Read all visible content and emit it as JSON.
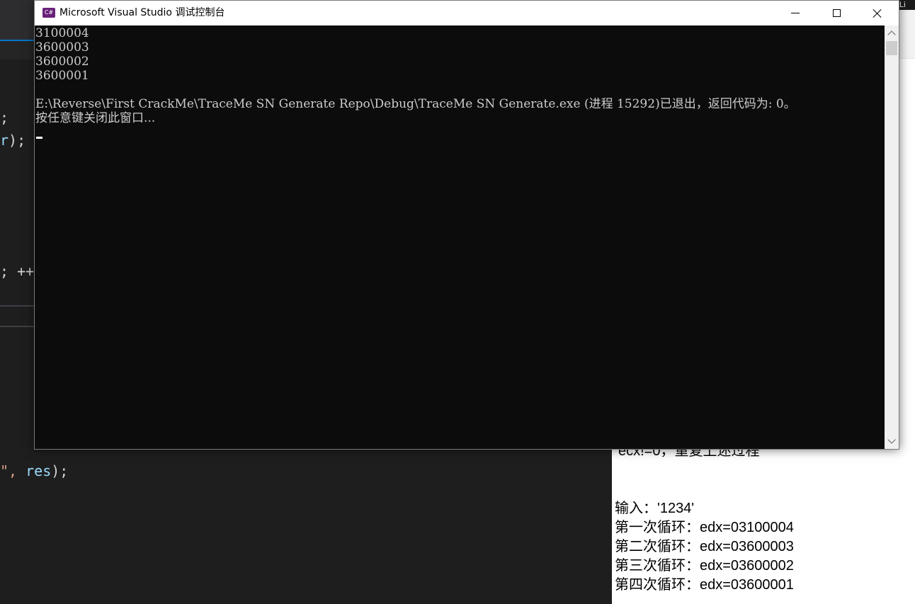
{
  "window": {
    "title": "Microsoft Visual Studio 调试控制台",
    "icon": "C#",
    "controls": [
      "minimize",
      "maximize",
      "close"
    ]
  },
  "console": {
    "lines": [
      "3100004",
      "3600003",
      "3600002",
      "3600001",
      "",
      "E:\\Reverse\\First CrackMe\\TraceMe SN Generate Repo\\Debug\\TraceMe SN Generate.exe (进程 15292)已退出，返回代码为: 0。",
      "按任意键关闭此窗口..."
    ]
  },
  "editor_fragments": {
    "line1": ";",
    "line2_var": "r",
    "line2_rest": ");",
    "line3": "; ++",
    "line4_str": "\",",
    "line4_var": "res",
    "line4_rest": ");"
  },
  "notes": {
    "partial_line": "ecx!=0，重复上述过程",
    "lines": [
      "输入：'1234'",
      "第一次循环：edx=03100004",
      "第二次循环：edx=03600003",
      "第三次循环：edx=03600002",
      "第四次循环：edx=03600001"
    ],
    "corner": "Li"
  },
  "colors": {
    "console_bg": "#0c0c0c",
    "console_text": "#cccccc",
    "editor_bg": "#1e1e1e",
    "vs_accent": "#68217a",
    "editor_var": "#9cdcfe",
    "editor_string": "#d69d85"
  }
}
